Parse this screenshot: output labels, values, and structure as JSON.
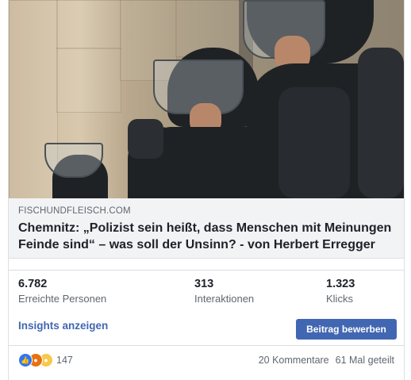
{
  "post": {
    "link_domain": "FISCHUNDFLEISCH.COM",
    "link_title": "Chemnitz: „Polizist sein heißt, dass Menschen mit Meinungen Feinde sind“ – was soll der Unsinn? - von Herbert Erregger",
    "image_icon": "riot-police-photo"
  },
  "stats": [
    {
      "value": "6.782",
      "label": "Erreichte Personen"
    },
    {
      "value": "313",
      "label": "Interaktionen"
    },
    {
      "value": "1.323",
      "label": "Klicks"
    }
  ],
  "actions": {
    "insights_label": "Insights anzeigen",
    "boost_label": "Beitrag bewerben"
  },
  "footer": {
    "reaction_icons": [
      "like-icon",
      "angry-icon",
      "sad-icon"
    ],
    "reaction_count": "147",
    "comments": "20 Kommentare",
    "shares": "61 Mal geteilt"
  },
  "colors": {
    "accent": "#4267b2",
    "secondary_text": "#606770",
    "link_bg": "#f2f3f5"
  }
}
